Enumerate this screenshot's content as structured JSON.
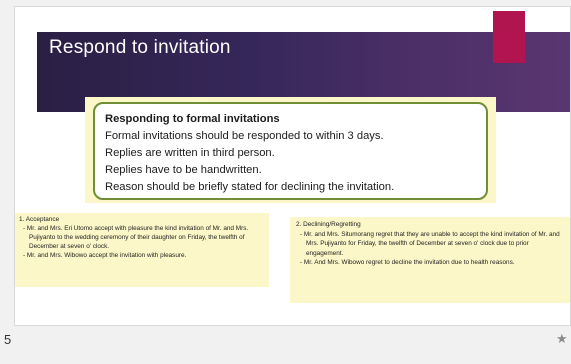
{
  "slide": {
    "title": "Respond to invitation",
    "number": "5",
    "colors": {
      "title_bar": "#36275a",
      "accent": "#b0154f",
      "box_border": "#6f8e35",
      "highlight": "#fbf7c8"
    },
    "box": {
      "heading": "Responding to formal invitations",
      "lines": [
        "Formal invitations should be responded to within 3 days.",
        "Replies are written in third person.",
        "Replies have to be handwritten.",
        "Reason should be briefly stated for declining the invitation."
      ]
    },
    "acceptance": {
      "heading": "1. Acceptance",
      "items": [
        "- Mr. and Mrs. Eri Utomo accept with pleasure the kind invitation of Mr. and Mrs. Pujiyanto to the wedding ceremony of their daughter on Friday, the twelfth of December at seven o' clock.",
        "- Mr. and Mrs. Wibowo accept the invitation with pleasure."
      ]
    },
    "declining": {
      "heading": "2. Declining/Regretting",
      "items": [
        "- Mr. and Mrs. Situmorang regret that they are unable to accept the kind invitation of Mr. and Mrs. Pujiyanto for Friday, the twelfth of December at seven o' clock due to prior engagement.",
        "- Mr. And Mrs. Wibowo regret to decline the invitation due to health reasons."
      ]
    },
    "star_icon": "star-icon"
  }
}
